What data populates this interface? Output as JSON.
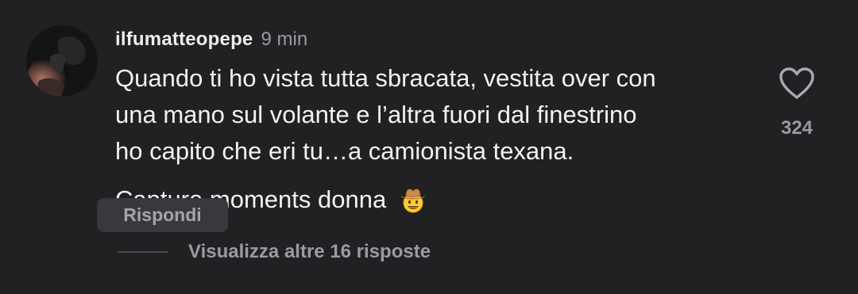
{
  "comment": {
    "username": "ilfumatteopepe",
    "time_ago": "9 min",
    "text_lines": [
      "Quando ti ho vista tutta sbracata, vestita over con",
      "una mano sul volante e l’altra fuori dal finestrino",
      "ho capito che eri tu…a camionista texana."
    ],
    "second_paragraph": "Capture moments donna",
    "emoji": "cowboy-hat-face-emoji",
    "reply_label": "Rispondi",
    "view_replies_label": "Visualizza altre 16 risposte",
    "like_count": "324"
  },
  "colors": {
    "background": "#212124",
    "text_primary": "#f2f2f2",
    "text_secondary": "#9a9aa0",
    "reply_button_bg": "#39393d"
  }
}
